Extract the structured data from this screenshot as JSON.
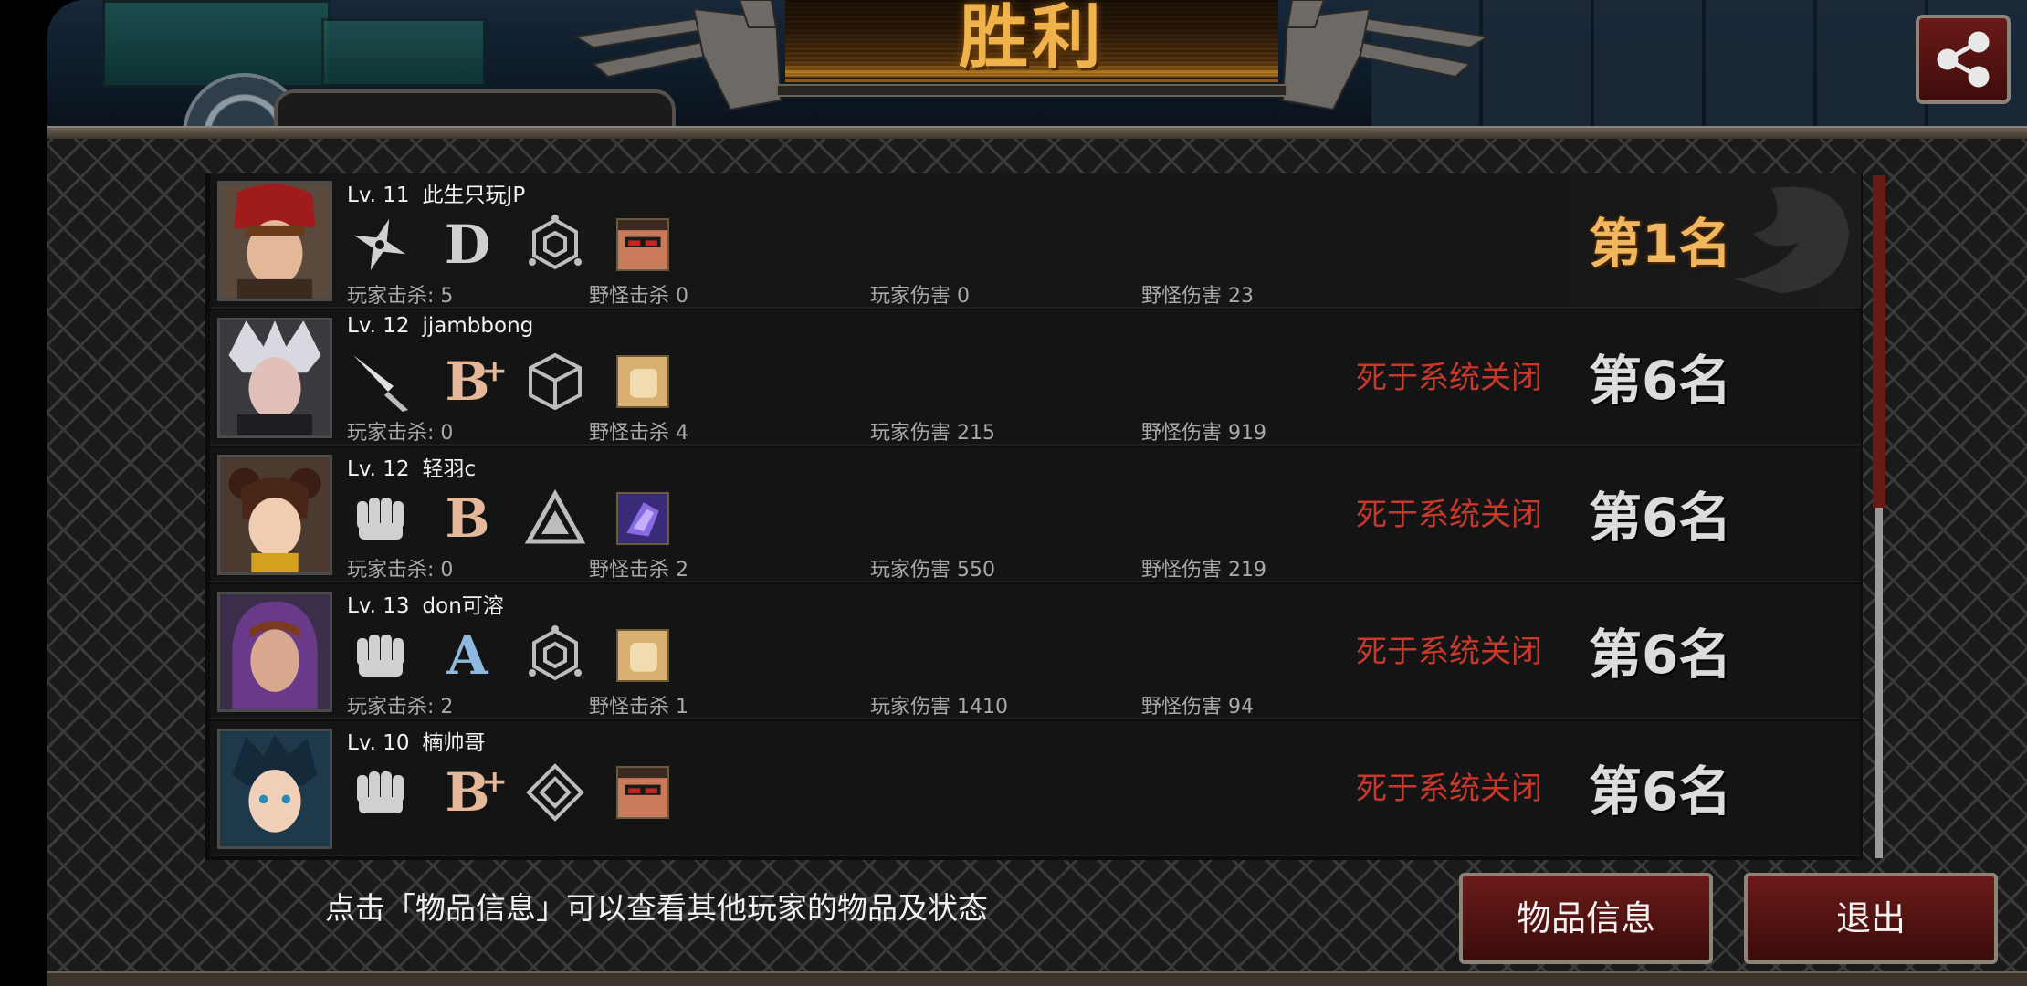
{
  "header": {
    "title": "胜利",
    "current_player_name_partial": "此生只玩JP",
    "share_icon": "share-icon",
    "colors": {
      "title": "#f0b24a",
      "button": "#6a1a18",
      "death_text": "#c8392c",
      "first_place": "#f0b760"
    }
  },
  "players": [
    {
      "level": "Lv. 11",
      "name": "此生只玩JP",
      "weapon_icon": "shuriken-icon",
      "grade": "D",
      "grade_plus": "",
      "grade_color": "#cfcfcf",
      "emblem_icon": "hexagon-emblem-icon",
      "item_thumb": "sunglasses-portrait-thumb",
      "stats": {
        "player_kills": "玩家击杀: 5",
        "monster_kills": "野怪击杀 0",
        "player_damage": "玩家伤害 0",
        "monster_damage": "野怪伤害 23"
      },
      "death_cause": "",
      "rank": "第1名",
      "is_winner": true
    },
    {
      "level": "Lv. 12",
      "name": "jjambbong",
      "weapon_icon": "knife-icon",
      "grade": "B",
      "grade_plus": "+",
      "grade_color": "#e6b89a",
      "emblem_icon": "cube-emblem-icon",
      "item_thumb": "fist-gold-thumb",
      "stats": {
        "player_kills": "玩家击杀: 0",
        "monster_kills": "野怪击杀 4",
        "player_damage": "玩家伤害 215",
        "monster_damage": "野怪伤害 919"
      },
      "death_cause": "死于系统关闭",
      "rank": "第6名",
      "is_winner": false
    },
    {
      "level": "Lv. 12",
      "name": "轻羽c",
      "weapon_icon": "fist-icon",
      "grade": "B",
      "grade_plus": "",
      "grade_color": "#e6b89a",
      "emblem_icon": "triangle-emblem-icon",
      "item_thumb": "purple-claw-thumb",
      "stats": {
        "player_kills": "玩家击杀: 0",
        "monster_kills": "野怪击杀 2",
        "player_damage": "玩家伤害 550",
        "monster_damage": "野怪伤害 219"
      },
      "death_cause": "死于系统关闭",
      "rank": "第6名",
      "is_winner": false
    },
    {
      "level": "Lv. 13",
      "name": "don可溶",
      "weapon_icon": "fist-icon",
      "grade": "A",
      "grade_plus": "",
      "grade_color": "#8fb8e0",
      "emblem_icon": "hexagon-emblem-icon",
      "item_thumb": "fist-gold-thumb",
      "stats": {
        "player_kills": "玩家击杀: 2",
        "monster_kills": "野怪击杀 1",
        "player_damage": "玩家伤害 1410",
        "monster_damage": "野怪伤害 94"
      },
      "death_cause": "死于系统关闭",
      "rank": "第6名",
      "is_winner": false
    },
    {
      "level": "Lv. 10",
      "name": "楠帅哥",
      "weapon_icon": "fist-icon",
      "grade": "B",
      "grade_plus": "+",
      "grade_color": "#e6b89a",
      "emblem_icon": "diamond-emblem-icon",
      "item_thumb": "sunglasses-portrait-thumb",
      "stats": {
        "player_kills": "",
        "monster_kills": "",
        "player_damage": "",
        "monster_damage": ""
      },
      "death_cause": "死于系统关闭",
      "rank": "第6名",
      "is_winner": false
    }
  ],
  "footer": {
    "hint": "点击「物品信息」可以查看其他玩家的物品及状态",
    "items_button": "物品信息",
    "exit_button": "退出"
  }
}
